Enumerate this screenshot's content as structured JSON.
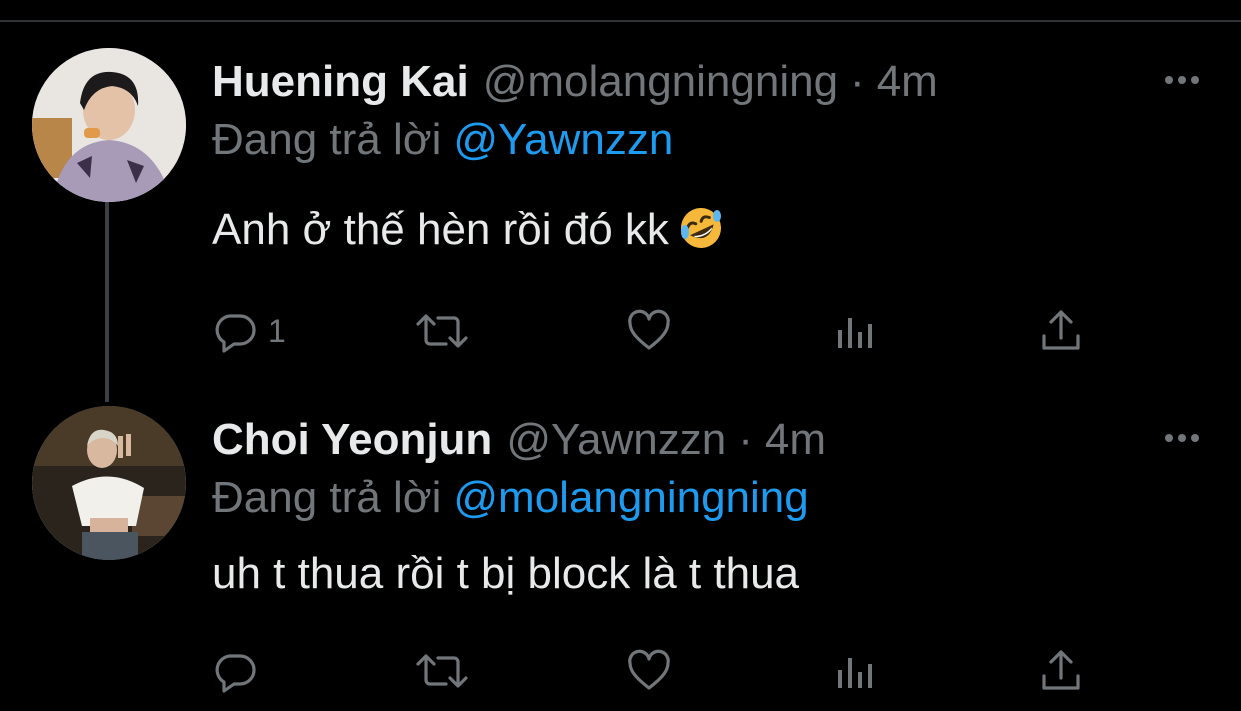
{
  "tweets": [
    {
      "name": "Huening Kai",
      "handle": "@molangningning",
      "separator": "·",
      "time": "4m",
      "reply_prefix": "Đang trả lời",
      "reply_to": "@Yawnzzn",
      "text": "Anh ở thế hèn rồi đó kk",
      "emoji": "rolling-on-floor-laughing",
      "reply_count": "1"
    },
    {
      "name": "Choi Yeonjun",
      "handle": "@Yawnzzn",
      "separator": "·",
      "time": "4m",
      "reply_prefix": "Đang trả lời",
      "reply_to": "@molangningning",
      "text": "uh t thua rồi t bị block là t thua",
      "reply_count": ""
    }
  ],
  "colors": {
    "background": "#000000",
    "primary_text": "#e7e9ea",
    "secondary_text": "#71767b",
    "mention": "#1d9bf0",
    "thread_line": "#3a3f44"
  },
  "icons": [
    "reply-icon",
    "retweet-icon",
    "like-icon",
    "analytics-icon",
    "share-icon",
    "more-icon"
  ]
}
